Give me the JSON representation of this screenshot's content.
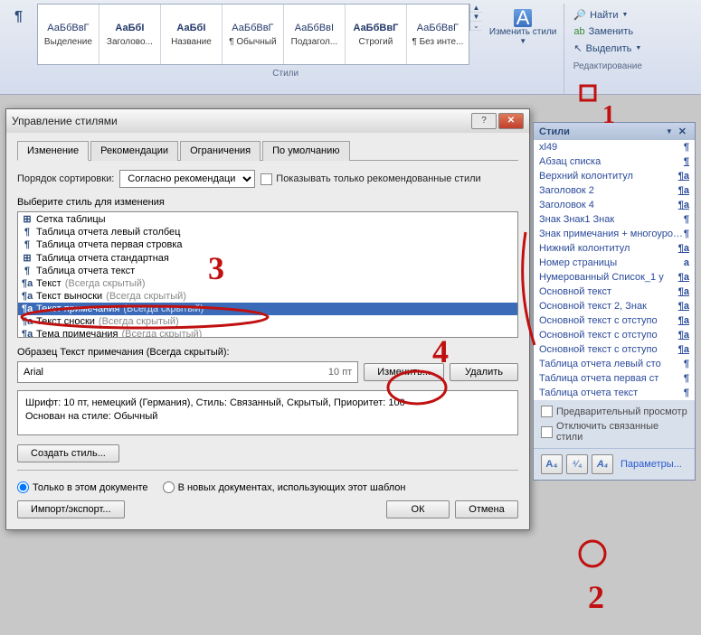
{
  "ribbon": {
    "styles_tiles": [
      {
        "preview": "АаБбВвГ",
        "label": "Выделение",
        "light": true
      },
      {
        "preview": "АаБбI",
        "label": "Заголово..."
      },
      {
        "preview": "АаБбI",
        "label": "Название"
      },
      {
        "preview": "АаБбВвГ",
        "label": "¶ Обычный",
        "light": true
      },
      {
        "preview": "АаБбВвI",
        "label": "Подзагол...",
        "light": true
      },
      {
        "preview": "АаБбВвГ",
        "label": "Строгий"
      },
      {
        "preview": "АаБбВвГ",
        "label": "¶ Без инте...",
        "light": true
      }
    ],
    "styles_group_label": "Стили",
    "change_styles_label": "Изменить стили",
    "edit_group_label": "Редактирование",
    "find_label": "Найти",
    "replace_label": "Заменить",
    "select_label": "Выделить"
  },
  "dialog": {
    "title": "Управление стилями",
    "tabs": [
      "Изменение",
      "Рекомендации",
      "Ограничения",
      "По умолчанию"
    ],
    "active_tab": 0,
    "sort_label": "Порядок сортировки:",
    "sort_value": "Согласно рекомендации",
    "show_recommended_label": "Показывать только рекомендованные стили",
    "choose_label": "Выберите стиль для изменения",
    "list": [
      {
        "marker": "⊞",
        "text": "Сетка таблицы"
      },
      {
        "marker": "¶",
        "text": "Таблица отчета левый столбец"
      },
      {
        "marker": "¶",
        "text": "Таблица отчета первая стровка"
      },
      {
        "marker": "⊞",
        "text": "Таблица отчета стандартная"
      },
      {
        "marker": "¶",
        "text": "Таблица отчета текст"
      },
      {
        "marker": "¶a",
        "text": "Текст",
        "dim": "(Всегда скрытый)"
      },
      {
        "marker": "¶a",
        "text": "Текст выноски",
        "dim": "(Всегда скрытый)"
      },
      {
        "marker": "¶a",
        "text": "Текст примечания",
        "dim": "(Всегда скрытый)",
        "selected": true
      },
      {
        "marker": "¶a",
        "text": "Текст сноски",
        "dim": "(Всегда скрытый)"
      },
      {
        "marker": "¶a",
        "text": "Тема примечания",
        "dim": "(Всегда скрытый)"
      }
    ],
    "sample_label": "Образец Текст примечания (Всегда скрытый):",
    "sample_font": "Arial",
    "sample_size": "10 пт",
    "modify_btn": "Изменить...",
    "delete_btn": "Удалить",
    "desc_line1": "Шрифт: 10 пт, немецкий (Германия), Стиль: Связанный, Скрытый, Приоритет: 100",
    "desc_line2": "Основан на стиле: Обычный",
    "create_style_btn": "Создать стиль...",
    "radio_this_doc": "Только в этом документе",
    "radio_new_docs": "В новых документах, использующих этот шаблон",
    "import_export_btn": "Импорт/экспорт...",
    "ok_btn": "ОК",
    "cancel_btn": "Отмена"
  },
  "styles_pane": {
    "title": "Стили",
    "items": [
      {
        "name": "xl49",
        "sym": "¶"
      },
      {
        "name": "Абзац списка",
        "sym": "¶",
        "u": true
      },
      {
        "name": "Верхний колонтитул",
        "sym": "¶a",
        "u": true
      },
      {
        "name": "Заголовок 2",
        "sym": "¶a",
        "u": true
      },
      {
        "name": "Заголовок 4",
        "sym": "¶a",
        "u": true
      },
      {
        "name": "Знак Знак1 Знак",
        "sym": "¶"
      },
      {
        "name": "Знак примечания + многоуровневый, Слева:",
        "sym": "¶"
      },
      {
        "name": "Нижний колонтитул",
        "sym": "¶a",
        "u": true
      },
      {
        "name": "Номер страницы",
        "sym": "a"
      },
      {
        "name": "Нумерованный Список_1 у",
        "sym": "¶a",
        "u": true
      },
      {
        "name": "Основной текст",
        "sym": "¶a",
        "u": true
      },
      {
        "name": "Основной текст 2, Знак",
        "sym": "¶a",
        "u": true
      },
      {
        "name": "Основной текст с отступо",
        "sym": "¶a",
        "u": true
      },
      {
        "name": "Основной текст с отступо",
        "sym": "¶a",
        "u": true
      },
      {
        "name": "Основной текст с отступо",
        "sym": "¶a",
        "u": true
      },
      {
        "name": "Таблица отчета левый сто",
        "sym": "¶"
      },
      {
        "name": "Таблица отчета первая ст",
        "sym": "¶"
      },
      {
        "name": "Таблица отчета текст",
        "sym": "¶"
      }
    ],
    "preview_check": "Предварительный просмотр",
    "disable_linked_check": "Отключить связанные стили",
    "params_link": "Параметры..."
  }
}
